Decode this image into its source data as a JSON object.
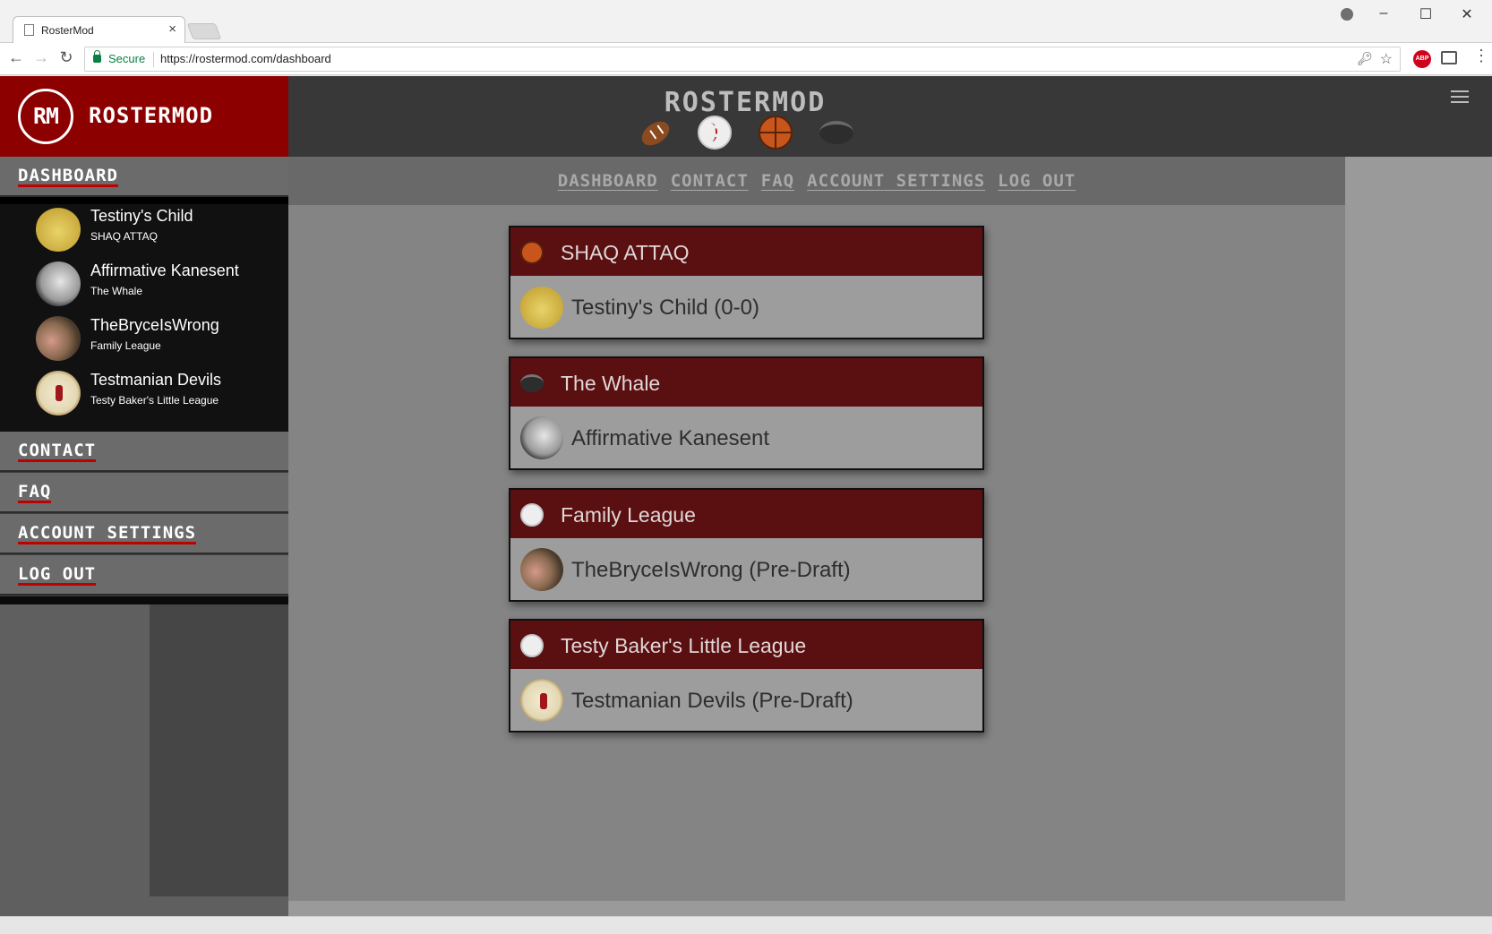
{
  "browser": {
    "tab_title": "RosterMod",
    "secure_label": "Secure",
    "url": "https://rostermod.com/dashboard"
  },
  "site": {
    "logo_initials": "RM",
    "logo_text": "ROSTERMOD",
    "header_title": "ROSTERMOD",
    "sport_icons": [
      "football-icon",
      "baseball-icon",
      "basketball-icon",
      "puck-icon"
    ]
  },
  "top_nav": [
    "DASHBOARD",
    "CONTACT",
    "FAQ",
    "ACCOUNT SETTINGS",
    "LOG OUT"
  ],
  "sidebar": {
    "dashboard": "DASHBOARD",
    "teams": [
      {
        "name": "Testiny's Child",
        "league": "SHAQ ATTAQ",
        "avatar": "jersey-icon"
      },
      {
        "name": "Affirmative Kanesent",
        "league": "The Whale",
        "avatar": "helmet-icon"
      },
      {
        "name": "TheBryceIsWrong",
        "league": "Family League",
        "avatar": "photo-icon"
      },
      {
        "name": "Testmanian Devils",
        "league": "Testy Baker's Little League",
        "avatar": "uniform-icon"
      }
    ],
    "links": [
      "CONTACT",
      "FAQ",
      "ACCOUNT SETTINGS",
      "LOG OUT"
    ]
  },
  "cards": [
    {
      "league": "SHAQ ATTAQ",
      "team": "Testiny's Child (0-0)",
      "sport_icon": "basketball-icon",
      "avatar": "jersey-icon"
    },
    {
      "league": "The Whale",
      "team": "Affirmative Kanesent",
      "sport_icon": "puck-icon",
      "avatar": "helmet-icon"
    },
    {
      "league": "Family League",
      "team": "TheBryceIsWrong (Pre-Draft)",
      "sport_icon": "baseball-icon",
      "avatar": "photo-icon"
    },
    {
      "league": "Testy Baker's Little League",
      "team": "Testmanian Devils (Pre-Draft)",
      "sport_icon": "baseball-icon",
      "avatar": "uniform-icon"
    }
  ],
  "colors": {
    "brand_red": "#8c0000",
    "card_header": "#5a0f11",
    "underline_red": "#c00000"
  }
}
